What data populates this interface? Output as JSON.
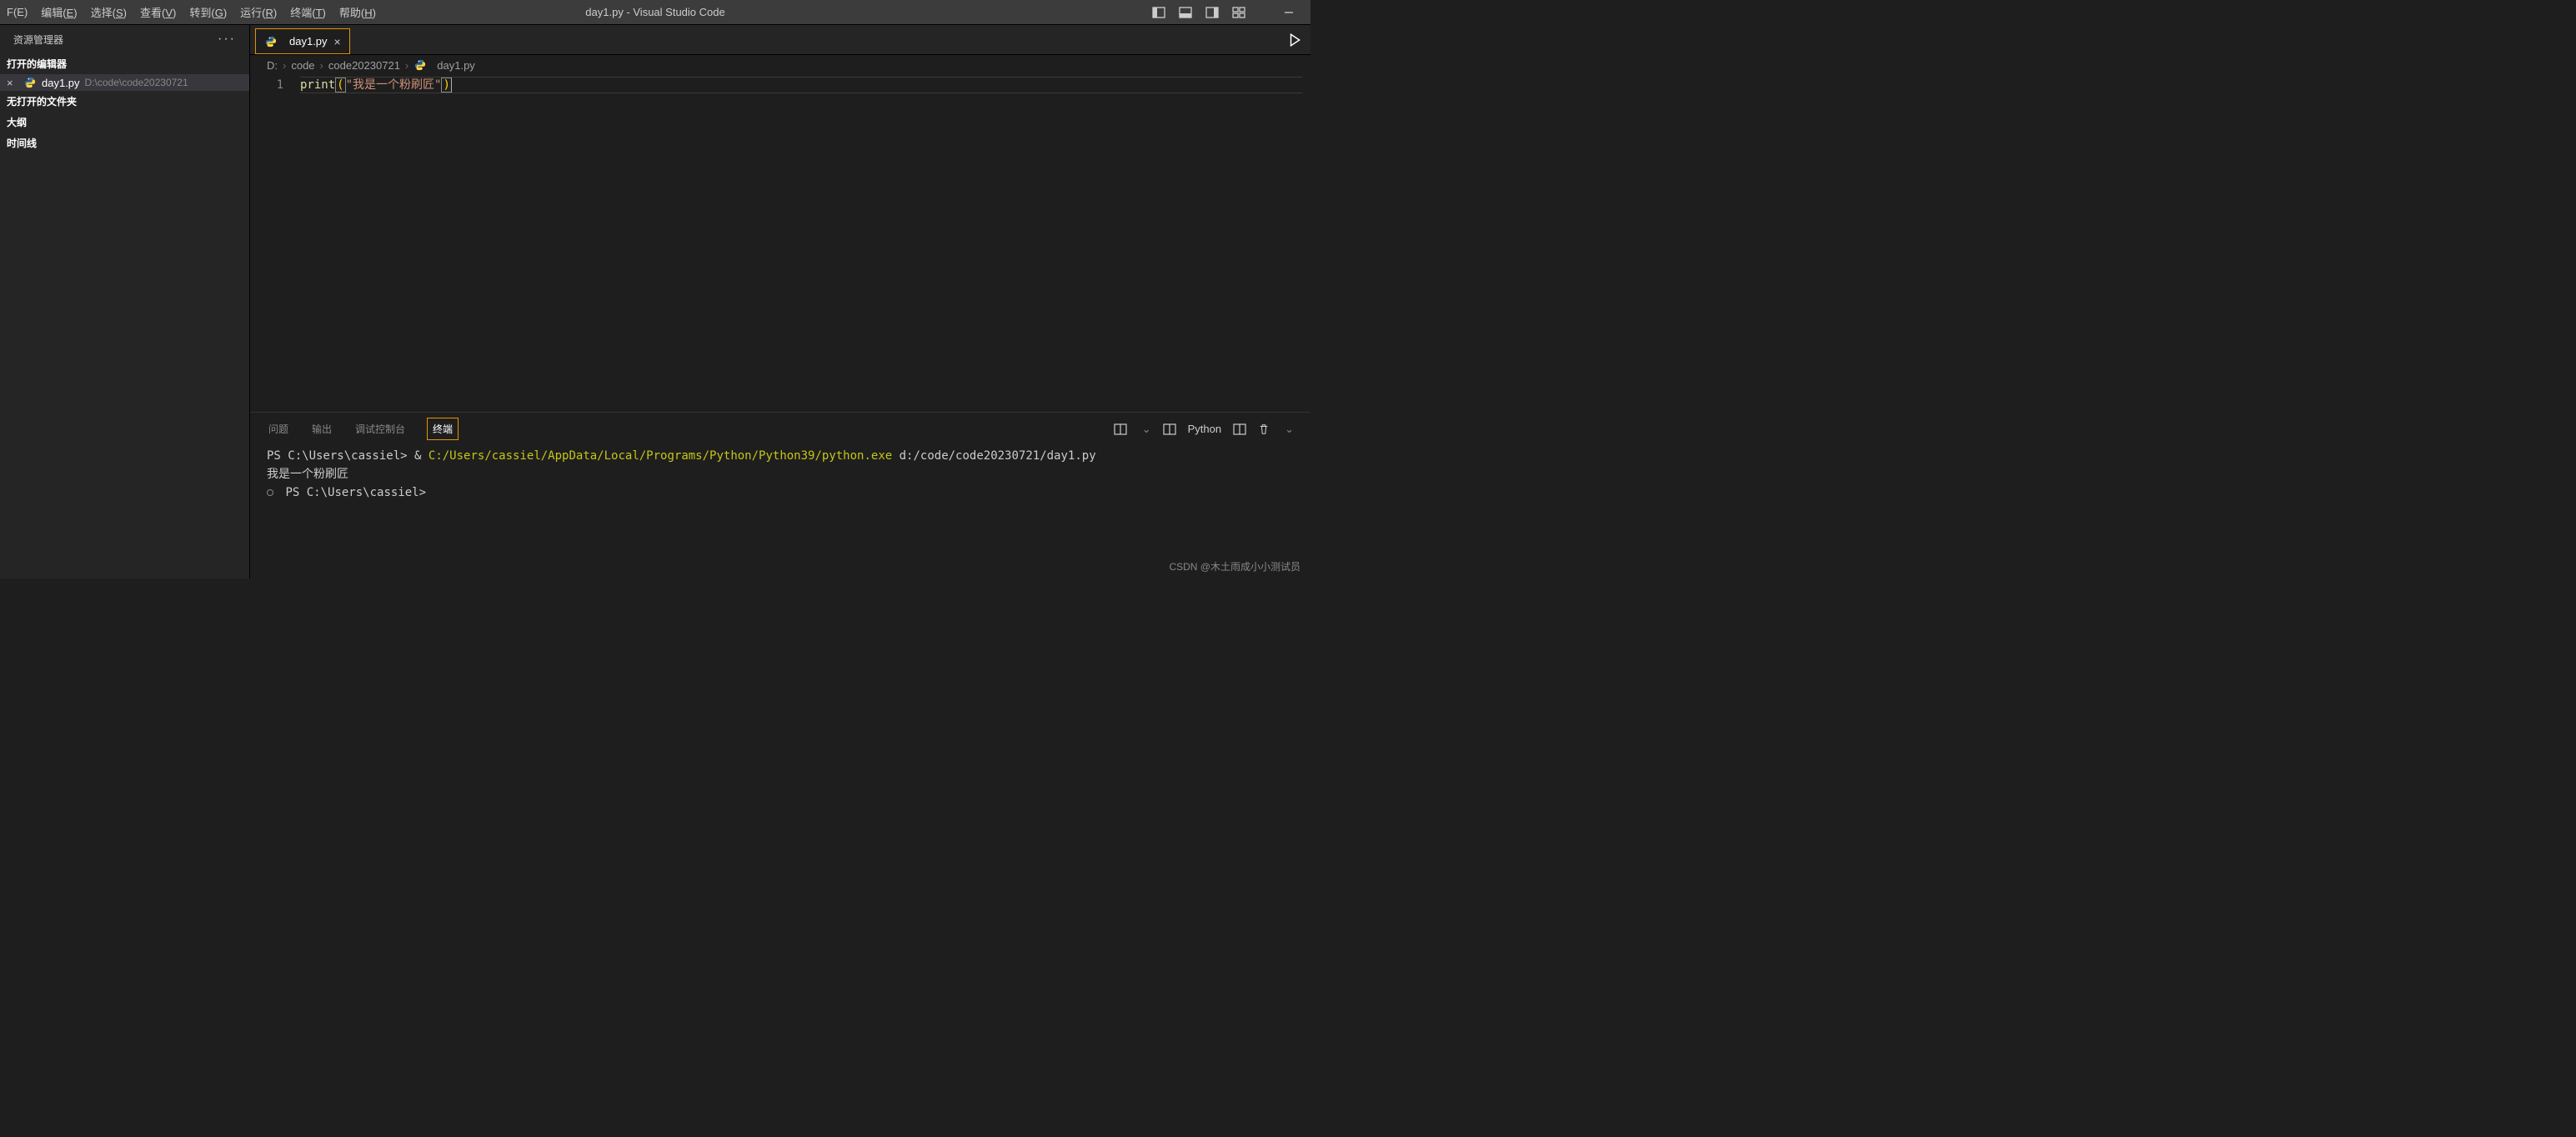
{
  "menu": {
    "file": "F(E)",
    "edit": "编辑(E)",
    "select": "选择(S)",
    "view": "查看(V)",
    "goto": "转到(G)",
    "run": "运行(R)",
    "terminal": "终端(T)",
    "help": "帮助(H)"
  },
  "title": "day1.py - Visual Studio Code",
  "sidebar": {
    "header": "资源管理器",
    "openEditors": "打开的编辑器",
    "file": {
      "name": "day1.py",
      "path": "D:\\code\\code20230721"
    },
    "noFolder": "无打开的文件夹",
    "outline": "大纲",
    "timeline": "时间线"
  },
  "tab": {
    "label": "day1.py"
  },
  "breadcrumb": {
    "d": "D:",
    "code": "code",
    "folder": "code20230721",
    "file": "day1.py"
  },
  "editor": {
    "lineNumber": "1",
    "fn": "print",
    "lparen": "(",
    "str": "\"我是一个粉刷匠\"",
    "rparen": ")"
  },
  "panel": {
    "tabs": {
      "problems": "问题",
      "output": "输出",
      "debug": "调试控制台",
      "terminal": "终端"
    },
    "shell": "Python"
  },
  "terminal": {
    "prompt1": "PS C:\\Users\\cassiel>",
    "amp": "&",
    "cmd": "C:/Users/cassiel/AppData/Local/Programs/Python/Python39/python.exe",
    "arg": "d:/code/code20230721/day1.py",
    "output": "我是一个粉刷匠",
    "prompt2": "PS C:\\Users\\cassiel>"
  },
  "watermark": "CSDN @木土雨成小小测试员"
}
